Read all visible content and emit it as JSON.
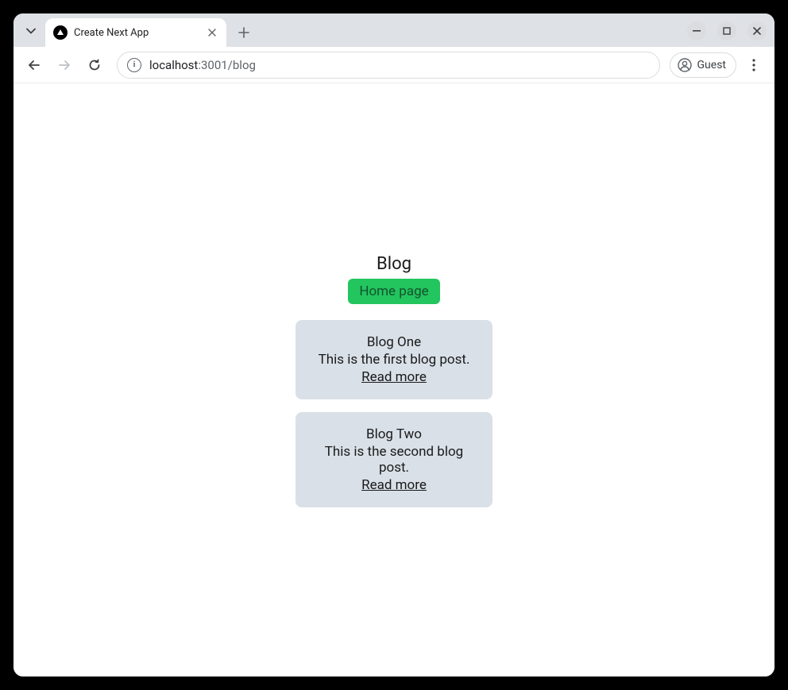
{
  "browser": {
    "tab": {
      "title": "Create Next App"
    },
    "url": {
      "host": "localhost",
      "port_path": ":3001/blog"
    },
    "profile": {
      "label": "Guest"
    }
  },
  "page": {
    "title": "Blog",
    "home_link": "Home page",
    "posts": [
      {
        "title": "Blog One",
        "description": "This is the first blog post.",
        "link": "Read more"
      },
      {
        "title": "Blog Two",
        "description": "This is the second blog post.",
        "link": "Read more"
      }
    ]
  }
}
